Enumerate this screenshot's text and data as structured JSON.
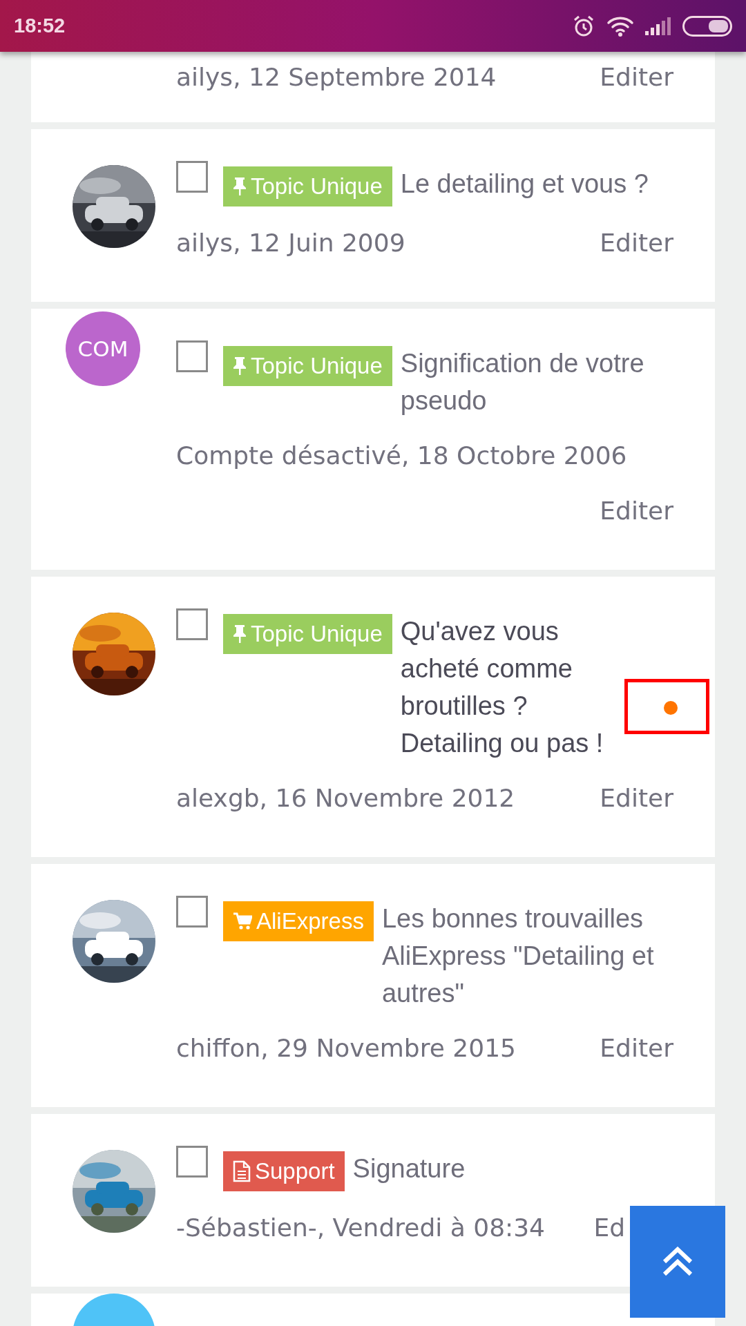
{
  "status_bar": {
    "time": "18:52"
  },
  "topics": [
    {
      "author_date": "ailys, 12 Septembre 2014",
      "edit": "Editer"
    },
    {
      "checked": false,
      "tag": {
        "kind": "pin",
        "label": "Topic Unique",
        "color": "#9acd5e"
      },
      "title": "Le detailing et vous ?",
      "unread": false,
      "author_date": "ailys, 12 Juin 2009",
      "edit": "Editer"
    },
    {
      "avatar": {
        "kind": "initials",
        "text": "COM",
        "color": "#bb66cc"
      },
      "checked": false,
      "tag": {
        "kind": "pin",
        "label": "Topic Unique",
        "color": "#9acd5e"
      },
      "title": "Signification de votre pseudo",
      "unread": false,
      "author_date": "Compte désactivé, 18 Octobre 2006",
      "edit": "Editer"
    },
    {
      "checked": false,
      "tag": {
        "kind": "pin",
        "label": "Topic Unique",
        "color": "#9acd5e"
      },
      "title": "Qu'avez vous acheté comme broutilles ? Detailing ou pas !",
      "unread": true,
      "author_date": "alexgb, 16 Novembre 2012",
      "edit": "Editer"
    },
    {
      "checked": false,
      "tag": {
        "kind": "cart",
        "label": "AliExpress",
        "color": "#ffa500"
      },
      "title": "Les bonnes trouvailles AliExpress \"Detailing et autres\"",
      "unread": false,
      "author_date": "chiffon, 29 Novembre 2015",
      "edit": "Editer"
    },
    {
      "checked": false,
      "tag": {
        "kind": "doc",
        "label": "Support",
        "color": "#e05a4e"
      },
      "title": "Signature",
      "unread": false,
      "author_date": "-Sébastien-, Vendredi à 08:34",
      "edit": "Ed"
    },
    {
      "avatar": {
        "kind": "initials",
        "color": "#4fc3f7"
      }
    }
  ]
}
